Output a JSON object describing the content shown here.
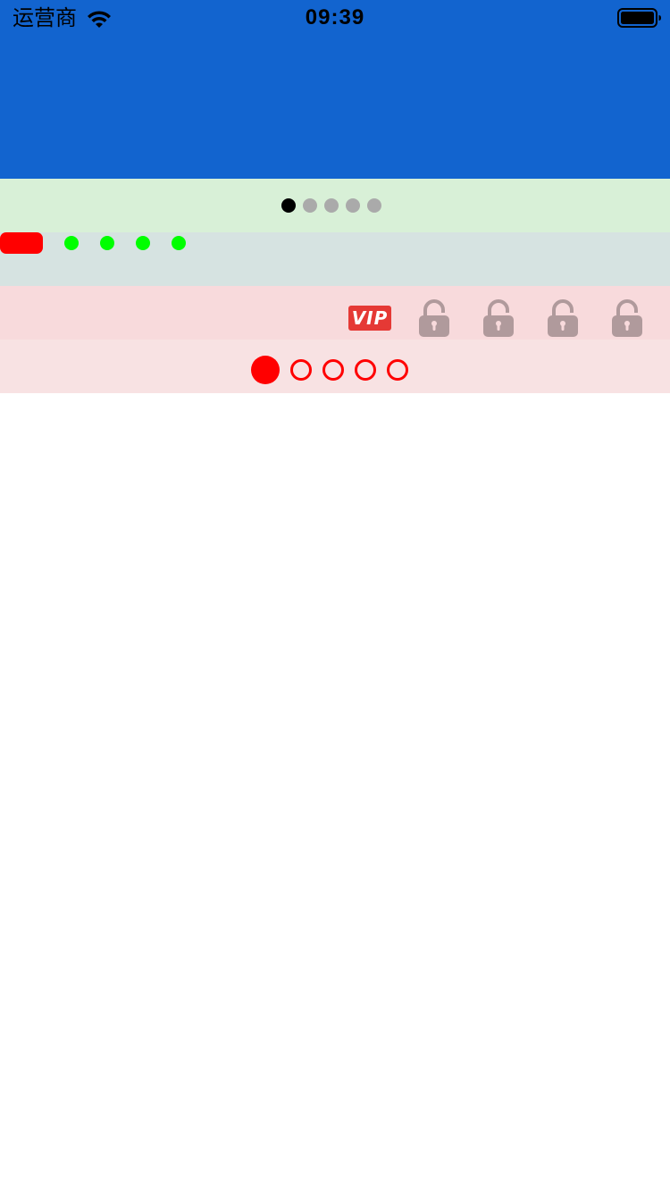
{
  "status_bar": {
    "carrier": "运营商",
    "time": "09:39",
    "icons": [
      "wifi-icon",
      "battery-icon"
    ]
  },
  "page_controls": [
    {
      "style": "default",
      "page_count": 5,
      "current_page": 1,
      "colors": {
        "active": "#000000",
        "inactive": "#AAAAAA",
        "background": "#D8F0D7"
      }
    },
    {
      "style": "pill-active",
      "page_count": 5,
      "current_page": 1,
      "colors": {
        "active": "#FF0000",
        "inactive": "#00FF00",
        "background": "#D6E3E1"
      }
    },
    {
      "style": "vip-locks",
      "vip_label": "VIP",
      "locked_pages": 4,
      "icons": [
        "lock-icon"
      ],
      "colors": {
        "vip": "#E53935",
        "lock": "#B09A9C",
        "background": "#F8DADC"
      }
    },
    {
      "style": "ring",
      "page_count": 5,
      "current_page": 1,
      "colors": {
        "active": "#FF0000",
        "inactive_border": "#FF0000",
        "background": "#F8E2E3"
      }
    }
  ],
  "colors": {
    "header": "#1264CF",
    "page_background": "#FFFFFF"
  }
}
